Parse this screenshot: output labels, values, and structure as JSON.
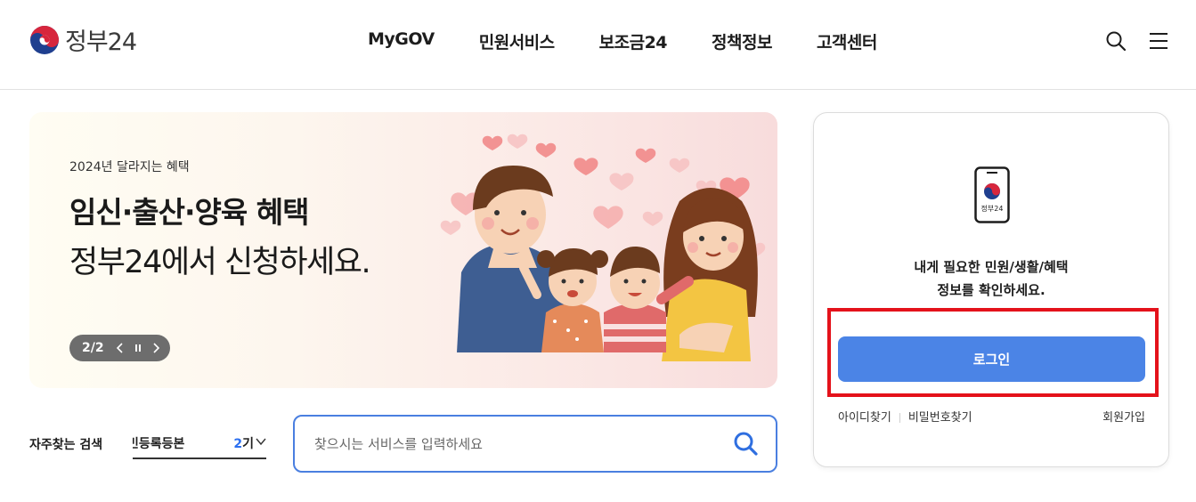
{
  "header": {
    "logo_text": "정부24",
    "nav": [
      {
        "label": "MyGOV"
      },
      {
        "label": "민원서비스"
      },
      {
        "label": "보조금24"
      },
      {
        "label": "정책정보"
      },
      {
        "label": "고객센터"
      }
    ],
    "icons": {
      "search": "search-icon",
      "menu": "hamburger-menu-icon"
    }
  },
  "banner": {
    "subtitle": "2024년 달라지는 혜택",
    "title": "임신·출산·양육 혜택",
    "line2": "정부24에서 신청하세요.",
    "page_indicator": "2/2",
    "controls": {
      "prev": "‹",
      "pause": "II",
      "next": "›"
    }
  },
  "search": {
    "frequent_label": "자주찾는 검색",
    "frequent_term": "민등록등본",
    "frequent_count": "2",
    "frequent_count_suffix": "기",
    "placeholder": "찾으시는 서비스를 입력하세요"
  },
  "login": {
    "phone_label": "정부24",
    "message_line1": "내게 필요한 민원/생활/혜택",
    "message_line2": "정보를 확인하세요.",
    "button": "로그인",
    "find_id": "아이디찾기",
    "find_pw": "비밀번호찾기",
    "signup": "회원가입"
  },
  "colors": {
    "accent": "#4b84e6",
    "highlight": "#e4121b",
    "search_border": "#4a7fe0",
    "logo_red": "#d7263d",
    "logo_blue": "#1f3f8f"
  }
}
